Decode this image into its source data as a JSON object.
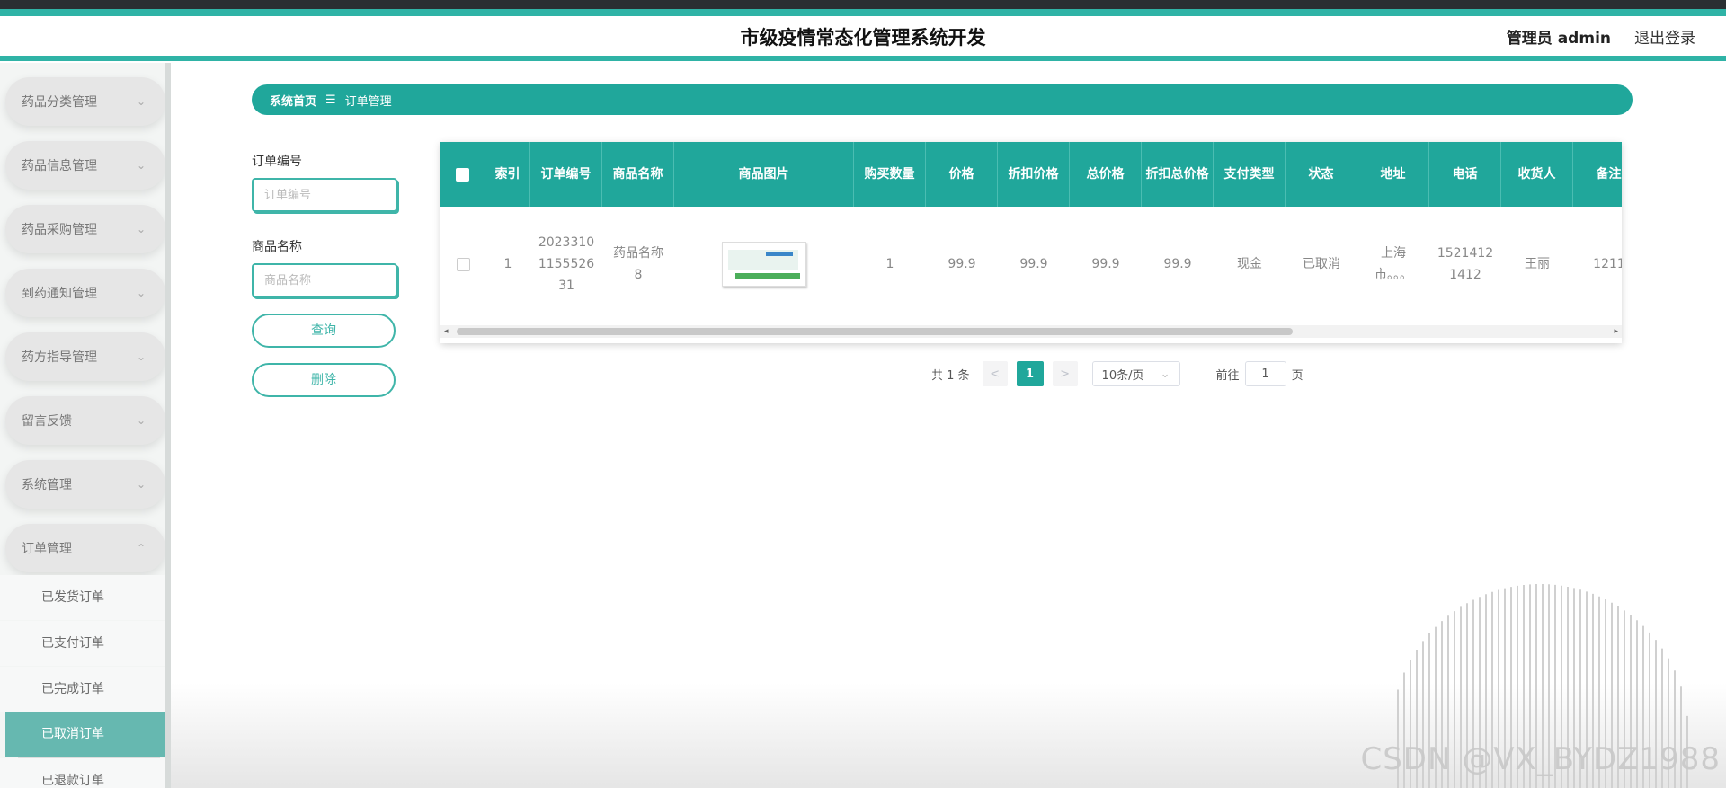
{
  "header": {
    "title": "市级疫情常态化管理系统开发",
    "admin": "管理员 admin",
    "logout": "退出登录"
  },
  "sidebar": {
    "menus": [
      {
        "label": "药品分类管理",
        "chevron": "⌄"
      },
      {
        "label": "药品信息管理",
        "chevron": "⌄"
      },
      {
        "label": "药品采购管理",
        "chevron": "⌄"
      },
      {
        "label": "到药通知管理",
        "chevron": "⌄"
      },
      {
        "label": "药方指导管理",
        "chevron": "⌄"
      },
      {
        "label": "留言反馈",
        "chevron": "⌄"
      },
      {
        "label": "系统管理",
        "chevron": "⌄"
      },
      {
        "label": "订单管理",
        "chevron": "⌃"
      }
    ],
    "submenu": [
      {
        "label": "已发货订单"
      },
      {
        "label": "已支付订单"
      },
      {
        "label": "已完成订单"
      },
      {
        "label": "已取消订单"
      },
      {
        "label": "已退款订单"
      }
    ],
    "active_submenu": "已取消订单"
  },
  "breadcrumb": {
    "home": "系统首页",
    "sep": "☰",
    "current": "订单管理"
  },
  "search": {
    "order_no_label": "订单编号",
    "order_no_placeholder": "订单编号",
    "product_name_label": "商品名称",
    "product_name_placeholder": "商品名称",
    "query_btn": "查询",
    "delete_btn": "删除"
  },
  "table": {
    "columns": [
      "索引",
      "订单编号",
      "商品名称",
      "商品图片",
      "购买数量",
      "价格",
      "折扣价格",
      "总价格",
      "折扣总价格",
      "支付类型",
      "状态",
      "地址",
      "电话",
      "收货人",
      "备注"
    ],
    "rows": [
      {
        "index": "1",
        "order_no": "2023310\n1155526\n31",
        "product_name": "药品名称\n8",
        "quantity": "1",
        "price": "99.9",
        "discount_price": "99.9",
        "total_price": "99.9",
        "discount_total": "99.9",
        "pay_type": "现金",
        "status": "已取消",
        "address": "上海\n市。。。",
        "phone": "1521412\n1412",
        "receiver": "王丽",
        "remark": "1211"
      }
    ]
  },
  "pager": {
    "total": "共 1 条",
    "prev": "<",
    "current": "1",
    "next": ">",
    "page_size": "10条/页",
    "size_chevron": "⌄",
    "goto_label": "前往",
    "goto_value": "1",
    "page_unit": "页"
  },
  "watermark": "CSDN @VX_BYDZ1988",
  "colors": {
    "primary": "#20a79b",
    "accent": "#2fb3a6",
    "active_submenu": "#66b8b0"
  }
}
